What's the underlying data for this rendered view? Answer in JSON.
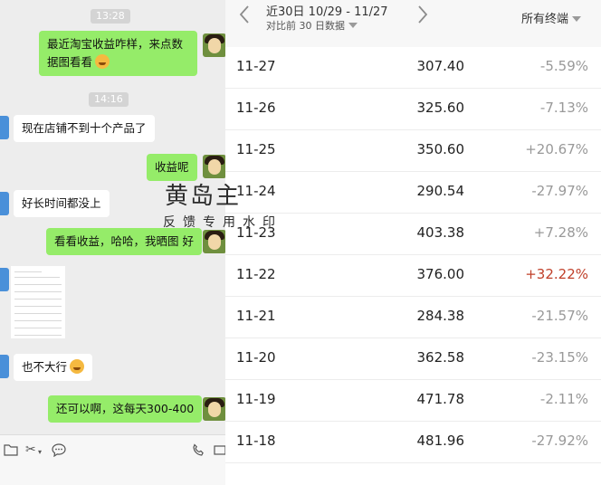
{
  "chat": {
    "timestamps": [
      "13:28",
      "14:16"
    ],
    "messages": [
      {
        "text": "最近淘宝收益咋样，来点数据图看看",
        "dir": "out"
      },
      {
        "text": "现在店铺不到十个产品了",
        "dir": "in"
      },
      {
        "text": "收益呢",
        "dir": "out"
      },
      {
        "text": "好长时间都没上",
        "dir": "in"
      },
      {
        "text": "看看收益，哈哈，我晒图 好",
        "dir": "out"
      },
      {
        "text": "也不大行",
        "dir": "in"
      },
      {
        "text": "还可以啊，这每天300-400",
        "dir": "out"
      }
    ],
    "toolbar_icons": [
      "folder-icon",
      "scissors-icon",
      "chat-bubble-icon",
      "phone-icon",
      "video-icon"
    ]
  },
  "watermark": {
    "title": "黄岛主",
    "subtitle": "反馈专用水印"
  },
  "stats": {
    "range_label": "近30日 10/29 - 11/27",
    "compare_label": "对比前 30 日数据",
    "terminal_label": "所有终端",
    "rows": [
      {
        "date": "11-27",
        "value": "307.40",
        "change": "-5.59%",
        "trend": "down"
      },
      {
        "date": "11-26",
        "value": "325.60",
        "change": "-7.13%",
        "trend": "down"
      },
      {
        "date": "11-25",
        "value": "350.60",
        "change": "+20.67%",
        "trend": "up"
      },
      {
        "date": "11-24",
        "value": "290.54",
        "change": "-27.97%",
        "trend": "down"
      },
      {
        "date": "11-23",
        "value": "403.38",
        "change": "+7.28%",
        "trend": "up"
      },
      {
        "date": "11-22",
        "value": "376.00",
        "change": "+32.22%",
        "trend": "up-highlight"
      },
      {
        "date": "11-21",
        "value": "284.38",
        "change": "-21.57%",
        "trend": "down"
      },
      {
        "date": "11-20",
        "value": "362.58",
        "change": "-23.15%",
        "trend": "down"
      },
      {
        "date": "11-19",
        "value": "471.78",
        "change": "-2.11%",
        "trend": "down"
      },
      {
        "date": "11-18",
        "value": "481.96",
        "change": "-27.92%",
        "trend": "down"
      }
    ]
  },
  "colors": {
    "outgoing_bubble": "#95ec69",
    "incoming_bubble": "#ffffff",
    "chat_background": "#ededed",
    "positive_highlight": "#c0402a"
  }
}
